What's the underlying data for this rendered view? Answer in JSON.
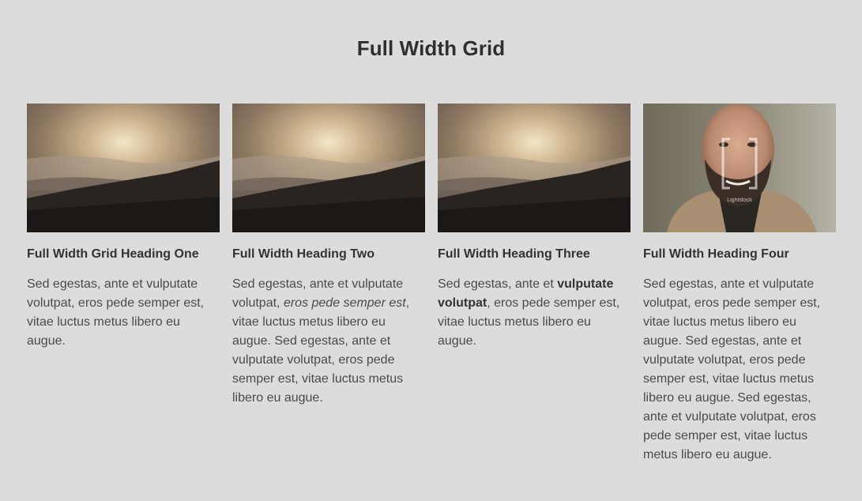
{
  "page": {
    "title": "Full Width Grid"
  },
  "cards": [
    {
      "heading": "Full Width Grid Heading One",
      "image": "landscape-sunset-hills",
      "text": "Sed egestas, ante et vulputate volutpat, eros pede semper est, vitae luctus metus libero eu augue."
    },
    {
      "heading": "Full Width Heading Two",
      "image": "landscape-sunset-hills",
      "text_a": "Sed egestas, ante et vulputate volutpat, ",
      "text_em": "eros pede semper est",
      "text_b": ", vitae luctus metus libero eu augue. Sed egestas, ante et vulputate volutpat, eros pede semper est, vitae luctus metus libero eu augue."
    },
    {
      "heading": "Full Width Heading Three",
      "image": "landscape-sunset-hills",
      "text_a": "Sed egestas, ante et ",
      "text_strong": "vulputate volutpat",
      "text_b": ", eros pede semper est, vitae luctus metus libero eu augue."
    },
    {
      "heading": "Full Width Heading Four",
      "image": "portrait-smiling-man",
      "watermark": "Lightstock",
      "text": "Sed egestas, ante et vulputate volutpat, eros pede semper est, vitae luctus metus libero eu augue. Sed egestas, ante et vulputate volutpat, eros pede semper est, vitae luctus metus libero eu augue. Sed egestas, ante et vulputate volutpat, eros pede semper est, vitae luctus metus libero eu augue."
    }
  ]
}
